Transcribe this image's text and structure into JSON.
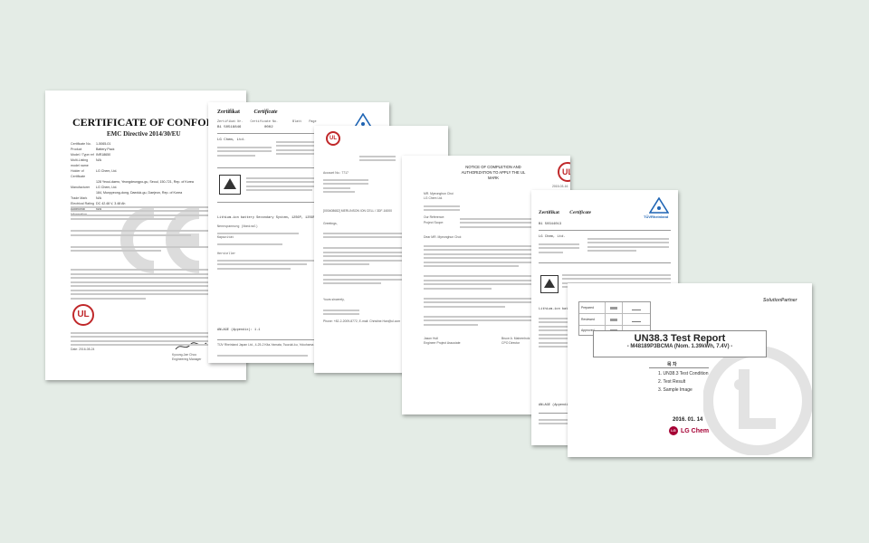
{
  "doc1": {
    "title": "CERTIFICATE OF CONFORMITY",
    "subtitle": "EMC Directive 2014/30/EU",
    "date": "Date: 2016-08-24",
    "ul_mark": "UL",
    "fields": [
      {
        "k": "Certificate No.",
        "v": "1-5065-01"
      },
      {
        "k": "Product",
        "v": "Battery Pack"
      },
      {
        "k": "Model / Type ref",
        "v": "INR18650"
      },
      {
        "k": "Multi-Listing model name",
        "v": "N/A"
      },
      {
        "k": "Holder of Certificate",
        "v": "LG Chem, Ltd."
      },
      {
        "k": "",
        "v": "128 Yeoui-daero, Yeongdeungpo-gu, Seoul, 150-721, Rep. of Korea"
      },
      {
        "k": "Manufacturer",
        "v": "LG Chem, Ltd."
      },
      {
        "k": "",
        "v": "184, Munpyeong-dong, Daeduk-gu, Daejeon, Rep. of Korea"
      },
      {
        "k": "Trade Mark",
        "v": "N/A"
      },
      {
        "k": "Electrical Rating",
        "v": "DC 42.48 V, 3.48 Ah"
      },
      {
        "k": "Additional Information",
        "v": "N/A"
      }
    ],
    "sign_name": "Kyoung-Jae Choo",
    "sign_role": "Engineering Manager"
  },
  "doc2": {
    "title": "Zertifikat",
    "title2": "Certificate",
    "labels": [
      "Zertifikat Nr.",
      "Certificate No.",
      "Blatt",
      "Page"
    ],
    "cert_no": "B1 50518846",
    "page_no": "0002",
    "holder": "LG Chem, Ltd.",
    "battery_label": "Lithium-ion battery Secondary System, 12S6P, 12S6P...",
    "footer": "TÜV Rheinland Japan Ltd., 4-25-2 Kita-Yamata, Tsuzuki-ku, Yokohama",
    "anlage": "ANLAGE (Appendix): 1.1",
    "sub_labels": [
      "Nennspannung (Nominal)",
      "Kapazität",
      "Hersteller"
    ]
  },
  "doc3": {
    "ul_mark": "UL",
    "greeting": "Greetings,",
    "closing": "Yours sincerely,",
    "phone": "Phone: +82-2-2009-8772, E-mail: Christine.Han@ul.com",
    "ref_line": "[000408682] MERLINSON ION CELL / 3DF-16000",
    "account": "Account No.: 7717"
  },
  "doc4": {
    "title": "NOTICE OF COMPLETION AND AUTHORIZATION TO APPLY THE UL MARK",
    "date": "2015-03-16",
    "ul_mark": "UL",
    "addressee": "MR. Myeonghun Choi",
    "company": "LG Chem Ltd.",
    "our_ref": "Our Reference:",
    "project_scope": "Project Scope:",
    "dear": "Dear MR. Myeonghun Choi:",
    "signed1": "Jason Hull",
    "signed1_role": "Engineer Project Associate",
    "signed2": "Bruce A. Mahrenholz",
    "signed2_role": "CPO Director"
  },
  "doc5": {
    "title": "Zertifikat",
    "title2": "Certificate",
    "brand": "TÜVRheinland",
    "cert_no": "B1 50344013",
    "holder": "LG Chem, Ltd.",
    "battery_label": "Lithium-ion battery",
    "anlage": "ANLAGE (Appendix): 1.1"
  },
  "doc6": {
    "brand": "SolutionPartner",
    "title": "UN38.3 Test Report",
    "model": "- M48189P3BCMA (Nom. 1.39kWh, 7.4V) -",
    "toc_header": "목 차",
    "toc": [
      "1. UN38.3 Test Condition",
      "2. Test Result",
      "3. Sample Image"
    ],
    "date": "2016. 01. 14",
    "company": "LG Chem",
    "approval_rows": [
      "Prepared",
      "Reviewed",
      "Approved"
    ]
  }
}
